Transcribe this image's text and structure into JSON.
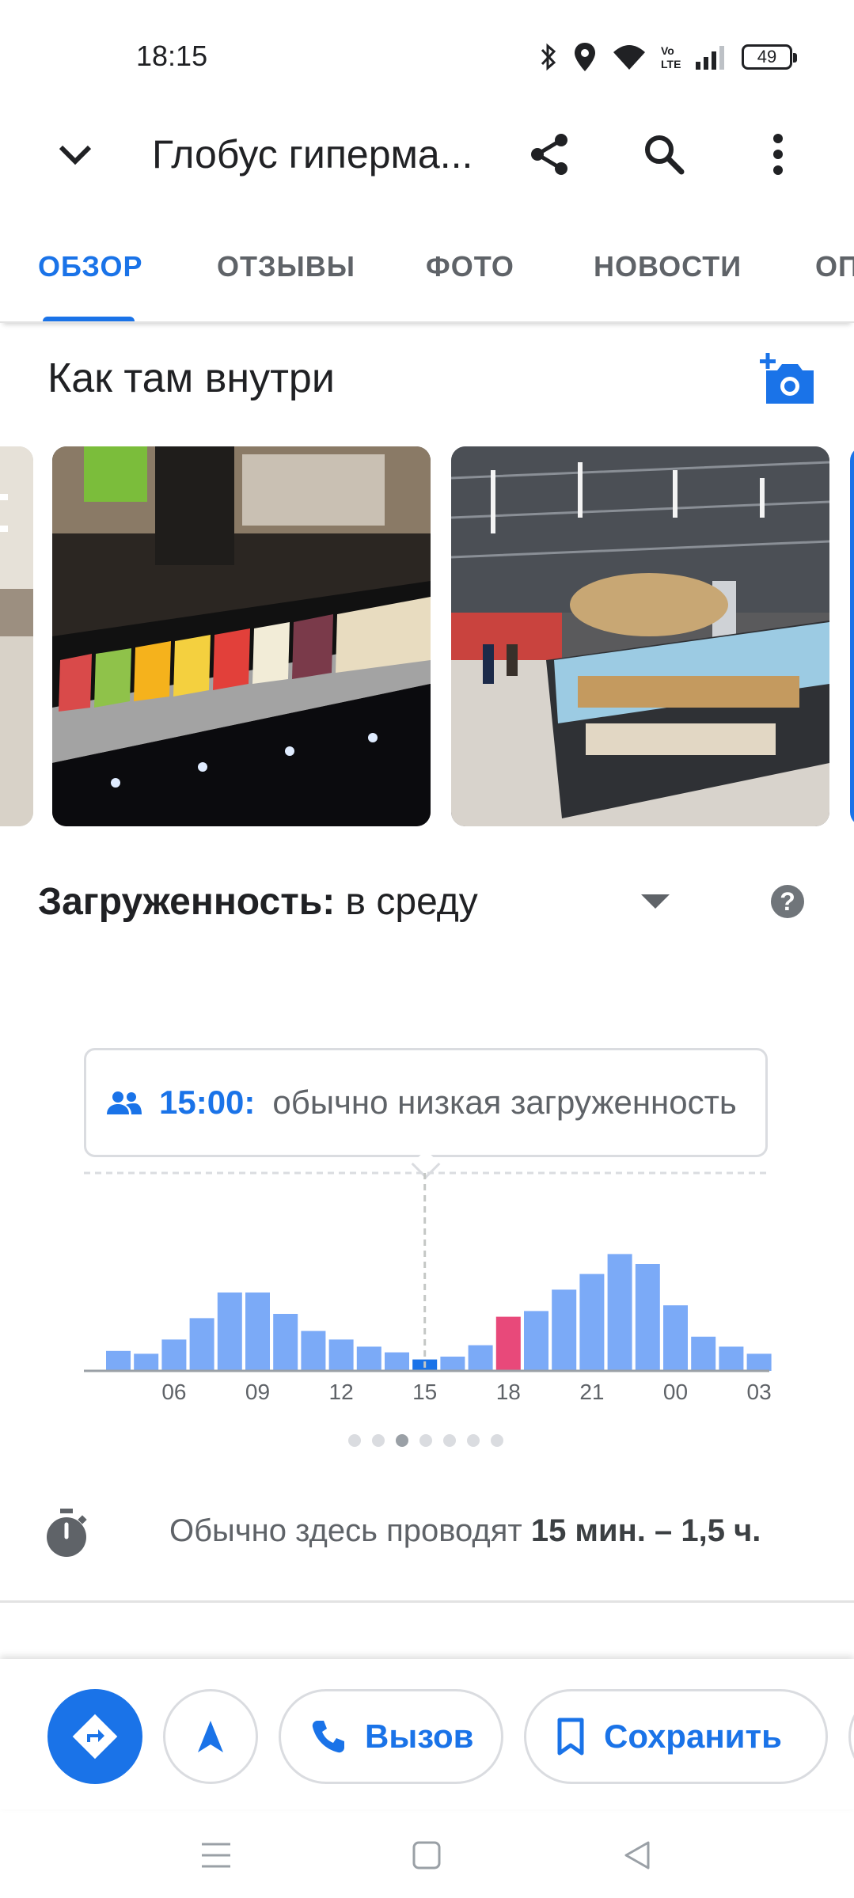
{
  "status_bar": {
    "time": "18:15",
    "battery": "49"
  },
  "header": {
    "title": "Глобус гиперма..."
  },
  "tabs": [
    {
      "label": "ОБЗОР"
    },
    {
      "label": "ОТЗЫВЫ"
    },
    {
      "label": "ФОТО"
    },
    {
      "label": "НОВОСТИ"
    },
    {
      "label": "ОП"
    }
  ],
  "inside": {
    "title": "Как там внутри"
  },
  "busyness": {
    "label": "Загруженность:",
    "day": "в среду",
    "tooltip_time": "15:00:",
    "tooltip_text": "обычно низкая загруженность",
    "page_index": 2,
    "page_count": 7
  },
  "chart_data": {
    "type": "bar",
    "x": [
      "04",
      "05",
      "06",
      "07",
      "08",
      "09",
      "10",
      "11",
      "12",
      "13",
      "14",
      "15",
      "16",
      "17",
      "18",
      "19",
      "20",
      "21",
      "22",
      "23",
      "00",
      "01",
      "02",
      "03"
    ],
    "tick_labels": [
      "06",
      "09",
      "12",
      "15",
      "18",
      "21",
      "00",
      "03"
    ],
    "values": [
      14,
      12,
      22,
      37,
      55,
      55,
      40,
      28,
      22,
      17,
      13,
      8,
      10,
      18,
      24,
      42,
      57,
      68,
      82,
      75,
      46,
      24,
      17,
      12
    ],
    "live_value": 38,
    "current_hour": "15",
    "live_hour": "18",
    "colors": {
      "bar": "#7baaf7",
      "current": "#1a73e8",
      "live": "#e8497a",
      "live_bg": "#e8eaed"
    }
  },
  "stay": {
    "text": "Обычно здесь проводят",
    "duration": "15 мин. – 1,5 ч."
  },
  "actions": {
    "call": "Вызов",
    "save": "Сохранить"
  },
  "colors": {
    "accent": "#1a73e8"
  }
}
